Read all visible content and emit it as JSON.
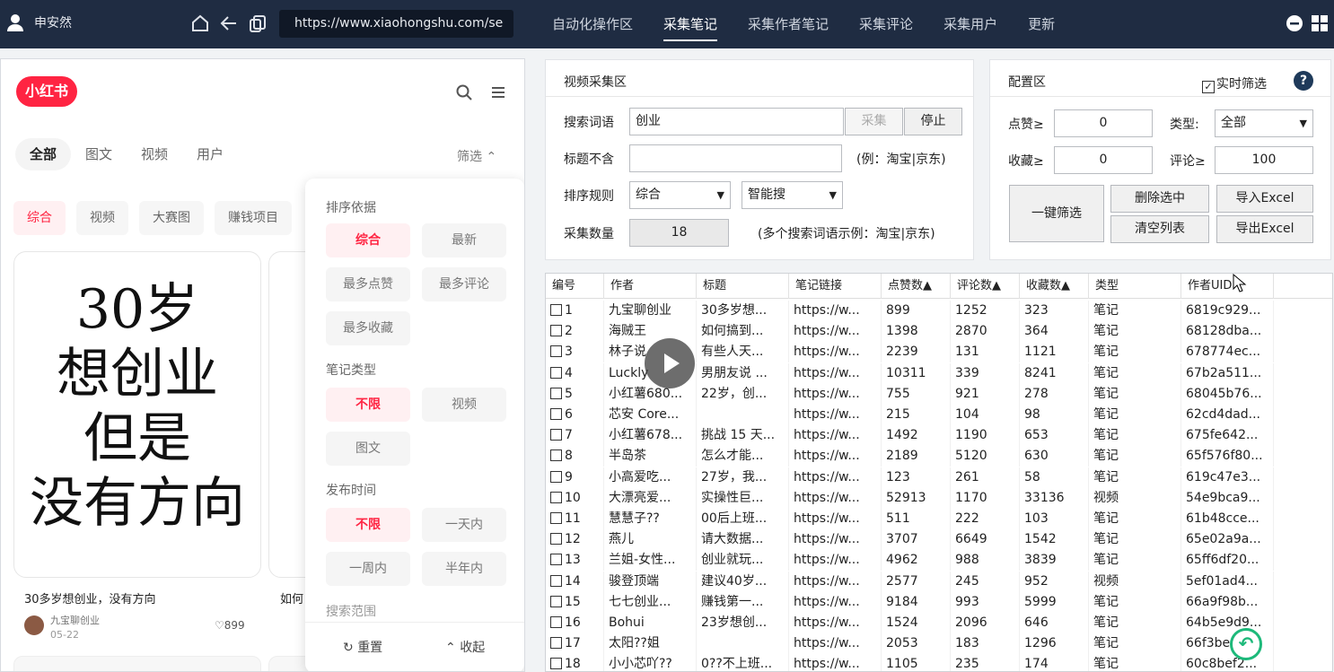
{
  "topbar": {
    "username": "申安然",
    "url": "https://www.xiaohongshu.com/se",
    "tabs": [
      "自动化操作区",
      "采集笔记",
      "采集作者笔记",
      "采集评论",
      "采集用户",
      "更新"
    ],
    "active_tab": 1
  },
  "xhs": {
    "logo": "小红书",
    "filter_tabs": [
      "全部",
      "图文",
      "视频",
      "用户"
    ],
    "filter_label": "筛选",
    "categories": [
      "综合",
      "视频",
      "大赛图",
      "赚钱项目"
    ],
    "card1": {
      "image_lines": [
        "30岁",
        "想创业",
        "但是",
        "没有方向"
      ],
      "title": "30多岁想创业，没有方向",
      "author": "九宝聊创业",
      "date": "05-22",
      "likes": "899"
    },
    "card2_title": "如何",
    "dropdown": {
      "sort_label": "排序依据",
      "sort_opts": [
        "综合",
        "最新",
        "最多点赞",
        "最多评论",
        "最多收藏"
      ],
      "type_label": "笔记类型",
      "type_opts": [
        "不限",
        "视频",
        "图文"
      ],
      "time_label": "发布时间",
      "time_opts": [
        "不限",
        "一天内",
        "一周内",
        "半年内"
      ],
      "range_label": "搜索范围",
      "reset": "重置",
      "collapse": "收起"
    }
  },
  "collect": {
    "title": "视频采集区",
    "keyword_label": "搜索词语",
    "keyword_value": "创业",
    "collect_btn": "采集",
    "stop_btn": "停止",
    "exclude_label": "标题不含",
    "exclude_value": "",
    "exclude_hint": "(例：淘宝|京东)",
    "sort_label": "排序规则",
    "sort_value": "综合",
    "search_mode": "智能搜",
    "count_label": "采集数量",
    "count_value": "18",
    "multi_hint": "(多个搜索词语示例：淘宝|京东)"
  },
  "config": {
    "title": "配置区",
    "realtime_label": "实时筛选",
    "realtime_checked": true,
    "help": "?",
    "likes_label": "点赞≥",
    "likes_value": "0",
    "type_label": "类型:",
    "type_value": "全部",
    "fav_label": "收藏≥",
    "fav_value": "0",
    "comment_label": "评论≥",
    "comment_value": "100",
    "one_click": "一键筛选",
    "delete_selected": "删除选中",
    "import_excel": "导入Excel",
    "clear_list": "清空列表",
    "export_excel": "导出Excel"
  },
  "table": {
    "columns": [
      "编号",
      "作者",
      "标题",
      "笔记链接",
      "点赞数▲",
      "评论数▲",
      "收藏数▲",
      "类型",
      "作者UID"
    ],
    "rows": [
      [
        "1",
        "九宝聊创业",
        "30多岁想...",
        "https://w...",
        "899",
        "1252",
        "323",
        "笔记",
        "6819c929..."
      ],
      [
        "2",
        "海贼王",
        "如何搞到...",
        "https://w...",
        "1398",
        "2870",
        "364",
        "笔记",
        "68128dba..."
      ],
      [
        "3",
        "林子说",
        "有些人天...",
        "https://w...",
        "2239",
        "131",
        "1121",
        "笔记",
        "678774ec..."
      ],
      [
        "4",
        "Luckly",
        "男朋友说 ...",
        "https://w...",
        "10311",
        "339",
        "8241",
        "笔记",
        "67b2a511..."
      ],
      [
        "5",
        "小红薯680...",
        "22岁，创...",
        "https://w...",
        "755",
        "921",
        "278",
        "笔记",
        "68045b76..."
      ],
      [
        "6",
        "芯安 Core...",
        "",
        "https://w...",
        "215",
        "104",
        "98",
        "笔记",
        "62cd4dad..."
      ],
      [
        "7",
        "小红薯678...",
        "挑战 15 天...",
        "https://w...",
        "1492",
        "1190",
        "653",
        "笔记",
        "675fe642..."
      ],
      [
        "8",
        "半岛茶",
        "怎么才能...",
        "https://w...",
        "2189",
        "5120",
        "630",
        "笔记",
        "65f576f80..."
      ],
      [
        "9",
        "小高爱吃...",
        "27岁，我...",
        "https://w...",
        "123",
        "261",
        "58",
        "笔记",
        "619c47e3..."
      ],
      [
        "10",
        "大漂亮爱...",
        "实操性巨...",
        "https://w...",
        "52913",
        "1170",
        "33136",
        "视频",
        "54e9bca9..."
      ],
      [
        "11",
        "慧慧子??",
        "00后上班...",
        "https://w...",
        "511",
        "222",
        "103",
        "笔记",
        "61b48cce..."
      ],
      [
        "12",
        "燕儿",
        "请大数据...",
        "https://w...",
        "3707",
        "6649",
        "1542",
        "笔记",
        "65e02a9a..."
      ],
      [
        "13",
        "兰姐-女性...",
        "创业就玩...",
        "https://w...",
        "4962",
        "988",
        "3839",
        "笔记",
        "65ff6df20..."
      ],
      [
        "14",
        "骏登顶端",
        "建议40岁...",
        "https://w...",
        "2577",
        "245",
        "952",
        "视频",
        "5ef01ad4..."
      ],
      [
        "15",
        "七七创业...",
        "赚钱第一...",
        "https://w...",
        "9184",
        "993",
        "5999",
        "笔记",
        "66a9f98b..."
      ],
      [
        "16",
        "Bohui",
        "23岁想创...",
        "https://w...",
        "1524",
        "2096",
        "646",
        "笔记",
        "64b5e9d9..."
      ],
      [
        "17",
        "太阳??姐",
        "",
        "https://w...",
        "2053",
        "183",
        "1296",
        "笔记",
        "66f3be..."
      ],
      [
        "18",
        "小小芯吖??",
        "0??不上班...",
        "https://w...",
        "1105",
        "235",
        "174",
        "笔记",
        "60c8bef2..."
      ]
    ]
  }
}
